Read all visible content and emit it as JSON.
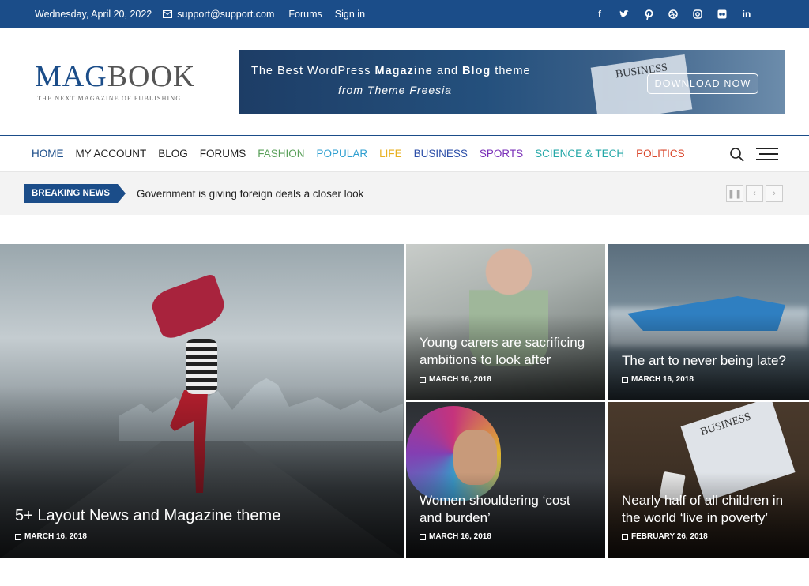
{
  "topbar": {
    "date": "Wednesday, April 20, 2022",
    "email": "support@support.com",
    "links": [
      "Forums",
      "Sign in"
    ],
    "social_icons": [
      "facebook-icon",
      "twitter-icon",
      "pinterest-icon",
      "dribbble-icon",
      "instagram-icon",
      "flickr-icon",
      "linkedin-icon"
    ]
  },
  "logo": {
    "name_part1": "MAG",
    "name_part2": "BOOK",
    "tagline": "THE NEXT MAGAZINE OF PUBLISHING"
  },
  "banner": {
    "line1_a": "The Best WordPress ",
    "line1_b": "Magazine",
    "line1_c": " and ",
    "line1_d": "Blog",
    "line1_e": " theme",
    "line2": "from Theme Freesia",
    "paper_text": "BUSINESS",
    "button": "DOWNLOAD NOW"
  },
  "nav": {
    "items": [
      {
        "label": "HOME",
        "color": "#1b4d89"
      },
      {
        "label": "MY ACCOUNT",
        "color": "#222222"
      },
      {
        "label": "BLOG",
        "color": "#222222"
      },
      {
        "label": "FORUMS",
        "color": "#222222"
      },
      {
        "label": "FASHION",
        "color": "#5aa05a"
      },
      {
        "label": "POPULAR",
        "color": "#2f9fd0"
      },
      {
        "label": "LIFE",
        "color": "#e8b020"
      },
      {
        "label": "BUSINESS",
        "color": "#2d4fa8"
      },
      {
        "label": "SPORTS",
        "color": "#7a2fb8"
      },
      {
        "label": "SCIENCE & TECH",
        "color": "#23a7a7"
      },
      {
        "label": "POLITICS",
        "color": "#d9462b"
      }
    ]
  },
  "breaking": {
    "label": "BREAKING NEWS",
    "text": "Government is giving foreign deals a closer look"
  },
  "posts": [
    {
      "title": "5+ Layout News and Magazine theme",
      "date": "MARCH 16, 2018"
    },
    {
      "title": "Young carers are sacrificing ambitions to look after",
      "date": "MARCH 16, 2018"
    },
    {
      "title": "The art to never being late?",
      "date": "MARCH 16, 2018"
    },
    {
      "title": "Women shouldering ‘cost and burden’",
      "date": "MARCH 16, 2018"
    },
    {
      "title": "Nearly half of all children in the world ‘live in poverty’",
      "date": "FEBRUARY 26, 2018"
    }
  ],
  "colors": {
    "brand": "#1b4d89"
  }
}
